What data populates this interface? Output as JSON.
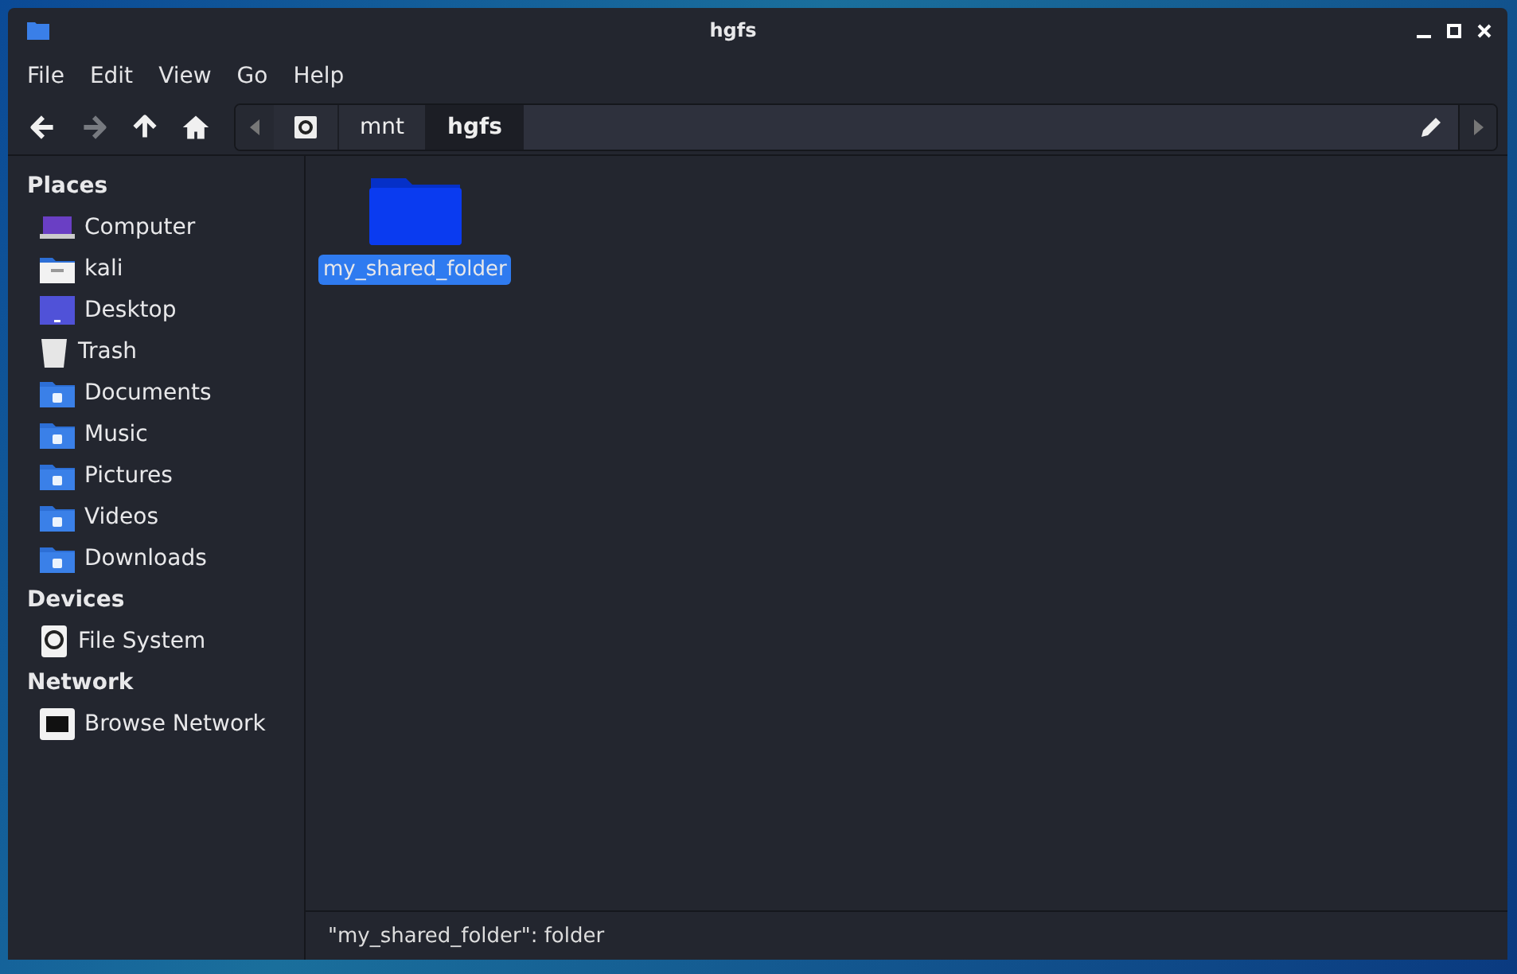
{
  "window": {
    "title": "hgfs"
  },
  "menu": [
    "File",
    "Edit",
    "View",
    "Go",
    "Help"
  ],
  "nav_buttons": [
    {
      "kind": "back",
      "disabled": false
    },
    {
      "kind": "forward",
      "disabled": true
    },
    {
      "kind": "up",
      "disabled": false
    },
    {
      "kind": "home",
      "disabled": false
    }
  ],
  "path": [
    {
      "kind": "root",
      "selected": false
    },
    {
      "kind": "text",
      "label": "mnt",
      "selected": false
    },
    {
      "kind": "text",
      "label": "hgfs",
      "selected": true
    }
  ],
  "sidebar": [
    {
      "heading": "Places",
      "items": [
        {
          "kind": "computer",
          "label": "Computer"
        },
        {
          "kind": "home",
          "label": "kali"
        },
        {
          "kind": "desktop",
          "label": "Desktop"
        },
        {
          "kind": "trash",
          "label": "Trash"
        },
        {
          "kind": "documents",
          "label": "Documents"
        },
        {
          "kind": "music",
          "label": "Music"
        },
        {
          "kind": "pictures",
          "label": "Pictures"
        },
        {
          "kind": "videos",
          "label": "Videos"
        },
        {
          "kind": "downloads",
          "label": "Downloads"
        }
      ]
    },
    {
      "heading": "Devices",
      "items": [
        {
          "kind": "drive",
          "label": "File System"
        }
      ]
    },
    {
      "heading": "Network",
      "items": [
        {
          "kind": "network",
          "label": "Browse Network"
        }
      ]
    }
  ],
  "files": [
    {
      "name": "my_shared_folder",
      "selected": true
    }
  ],
  "status_bar": "\"my_shared_folder\": folder"
}
